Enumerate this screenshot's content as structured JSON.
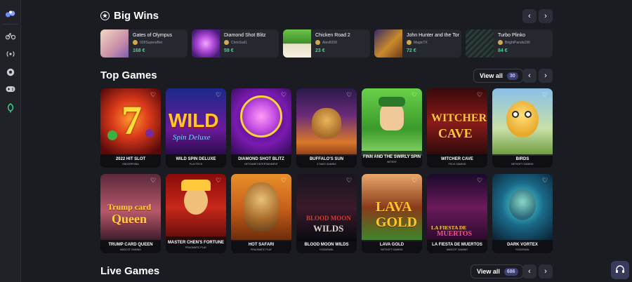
{
  "sidebar": {
    "icons": [
      "logo-icon",
      "bike-icon",
      "live-icon",
      "soccer-ball-icon",
      "gamepad-icon",
      "leaf-icon"
    ]
  },
  "big_wins": {
    "title": "Big Wins",
    "items": [
      {
        "game": "Gates of Olympus",
        "user": "028SuperaBet",
        "amount": "168 €"
      },
      {
        "game": "Diamond Shot Blitz",
        "user": "ChrisSail1",
        "amount": "59 €"
      },
      {
        "game": "Chicken Road 2",
        "user": "Alex8208",
        "amount": "23 €"
      },
      {
        "game": "John Hunter and the Tor",
        "user": "MagicTX",
        "amount": "72 €"
      },
      {
        "game": "Turbo Plinko",
        "user": "BrightPanda196",
        "amount": "84 €"
      }
    ]
  },
  "top_games": {
    "title": "Top Games",
    "view_all_label": "View all",
    "view_all_count": "30",
    "row1": [
      {
        "name": "2022 HIT SLOT",
        "provider": "ENDORPHINA"
      },
      {
        "name": "WILD SPIN DELUXE",
        "provider": "PLAYTECH"
      },
      {
        "name": "DIAMOND SHOT BLITZ",
        "provider": "NETGAME ENTERTAINMENT"
      },
      {
        "name": "BUFFALO'S SUN",
        "provider": "3 OAKS GAMING"
      },
      {
        "name": "FINN AND THE SWIRLY SPIN",
        "provider": "NETENT"
      },
      {
        "name": "WITCHER CAVE",
        "provider": "FELIX GAMING"
      },
      {
        "name": "BIRDS",
        "provider": "BETSOFT GAMING"
      }
    ],
    "row2": [
      {
        "name": "TRUMP CARD QUEEN",
        "provider": "MASCOT GAMING"
      },
      {
        "name": "MASTER CHEN'S FORTUNE",
        "provider": "PRAGMATIC PLAY"
      },
      {
        "name": "HOT SAFARI",
        "provider": "PRAGMATIC PLAY"
      },
      {
        "name": "BLOOD MOON WILDS",
        "provider": "YGGDRASIL"
      },
      {
        "name": "LAVA GOLD",
        "provider": "BETSOFT GAMING"
      },
      {
        "name": "LA FIESTA DE MUERTOS",
        "provider": "MASCOT GAMING"
      },
      {
        "name": "DARK VORTEX",
        "provider": "YGGDRASIL"
      }
    ]
  },
  "live_games": {
    "title": "Live Games",
    "view_all_label": "View all",
    "view_all_count": "686"
  },
  "colors": {
    "background": "#1a1c21",
    "card": "#262830",
    "accent_green": "#2fe08e",
    "badge": "#3d3f6e"
  }
}
